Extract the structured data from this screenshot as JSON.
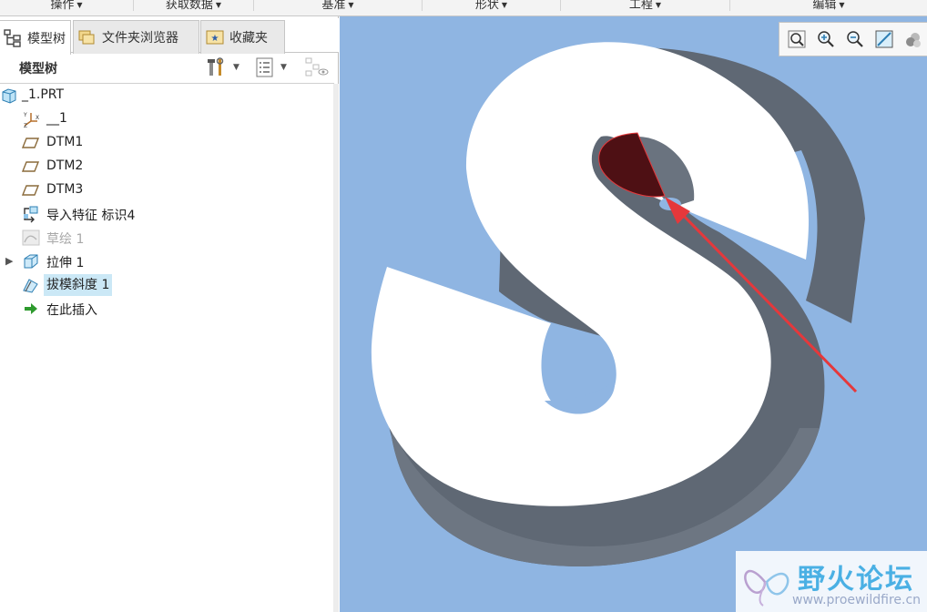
{
  "ribbon": {
    "groups": [
      {
        "label": "操作"
      },
      {
        "label": "获取数据"
      },
      {
        "label": "基准"
      },
      {
        "label": "形状"
      },
      {
        "label": "工程"
      },
      {
        "label": "编辑"
      }
    ]
  },
  "left_panel": {
    "tabs": [
      {
        "label": "模型树",
        "icon": "model-tree-icon",
        "active": true
      },
      {
        "label": "文件夹浏览器",
        "icon": "folder-browser-icon",
        "active": false
      },
      {
        "label": "收藏夹",
        "icon": "favorites-icon",
        "active": false
      }
    ],
    "tree_title": "模型树",
    "tree": [
      {
        "label": "_1.PRT",
        "icon": "part-icon"
      },
      {
        "label": "__1",
        "icon": "coordinate-system-icon"
      },
      {
        "label": "DTM1",
        "icon": "datum-plane-icon"
      },
      {
        "label": "DTM2",
        "icon": "datum-plane-icon"
      },
      {
        "label": "DTM3",
        "icon": "datum-plane-icon"
      },
      {
        "label": "导入特征 标识4",
        "icon": "import-feature-icon"
      },
      {
        "label": "草绘 1",
        "icon": "sketch-icon",
        "dimmed": true
      },
      {
        "label": "拉伸 1",
        "icon": "extrude-icon",
        "expandable": true
      },
      {
        "label": "拔模斜度 1",
        "icon": "draft-icon",
        "selected": true
      },
      {
        "label": "在此插入",
        "icon": "insert-here-arrow-icon"
      }
    ]
  },
  "view_toolbar": {
    "buttons": [
      "refit-icon",
      "zoom-in-icon",
      "zoom-out-icon",
      "repaint-icon",
      "display-style-icon"
    ]
  },
  "watermark": {
    "title": "野火论坛",
    "url": "www.proewildfire.cn"
  },
  "colors": {
    "viewport_bg": "#8fb5e2",
    "model_face": "#ffffff",
    "model_side": "#5f6874",
    "highlight_surface": "#4e1014",
    "arrow": "#e5383b"
  }
}
